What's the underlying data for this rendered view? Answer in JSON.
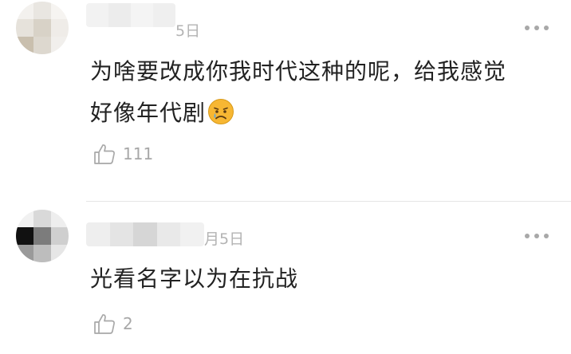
{
  "comments": [
    {
      "date": "5日",
      "lines": [
        "为啥要改成你我时代这种的呢，给我感觉",
        "好像年代剧"
      ],
      "emoji": "sad-tear-face-icon",
      "likes": "111"
    },
    {
      "date": "月5日",
      "lines": [
        "光看名字以为在抗战"
      ],
      "likes": "2"
    }
  ],
  "colors": {
    "text": "#222222",
    "meta": "#b3b3b3",
    "icon": "#a8a8a8",
    "divider": "#e5e5e5"
  }
}
